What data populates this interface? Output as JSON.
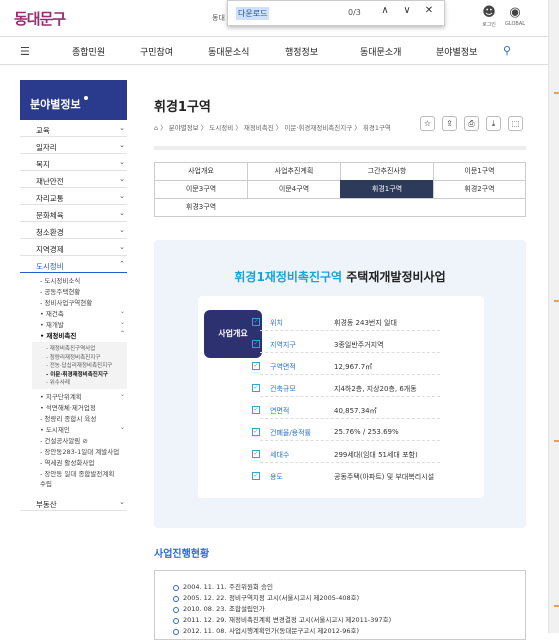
{
  "header": {
    "logo": "동대문구",
    "mid_text": "동대",
    "login": "로그인",
    "global": "GLOBAL"
  },
  "find": {
    "query": "다운로드",
    "count": "0/3",
    "prev": "∧",
    "next": "∨",
    "close": "✕"
  },
  "nav": {
    "items": [
      "종합민원",
      "구민참여",
      "동대문소식",
      "행정정보",
      "동대문소개",
      "분야별정보"
    ]
  },
  "sidebar": {
    "title": "분야별정보",
    "top": [
      {
        "label": "교육",
        "chev": "⌄"
      },
      {
        "label": "일자리",
        "chev": "⌄"
      },
      {
        "label": "복지",
        "chev": "⌄"
      },
      {
        "label": "재난안전",
        "chev": "⌄"
      },
      {
        "label": "자리교통",
        "chev": "⌄"
      },
      {
        "label": "문화체육",
        "chev": "⌄"
      },
      {
        "label": "청소환경",
        "chev": "⌄"
      },
      {
        "label": "지역경제",
        "chev": "⌄"
      },
      {
        "label": "도시정비",
        "chev": "⌃"
      }
    ],
    "sub": [
      {
        "label": "- 도시정비소식",
        "chev": ""
      },
      {
        "label": "- 공동주택현황",
        "chev": ""
      },
      {
        "label": "- 정비사업구역현황",
        "chev": ""
      },
      {
        "label": "• 재건축",
        "chev": "⌄"
      },
      {
        "label": "• 재개발",
        "chev": "⌄"
      },
      {
        "label": "• 재정비촉진",
        "chev": "⌃"
      }
    ],
    "sub2": [
      "- 재정비촉진구역사업",
      "- 청량리재정비촉진지구",
      "- 전농·답십리재정비촉진지구",
      "- 이문·휘경재정비촉진지구",
      "- 위수사례"
    ],
    "sub3": [
      {
        "label": "• 지구단위계획",
        "chev": "⌄"
      },
      {
        "label": "• 석면해체·제거업정",
        "chev": ""
      },
      {
        "label": "- 청량리 종합시 육성",
        "chev": ""
      },
      {
        "label": "• 도시재인",
        "chev": "⌄"
      },
      {
        "label": "- 건설공사알림 ⊘",
        "chev": ""
      },
      {
        "label": "- 장안동283-1일대 계발사업",
        "chev": ""
      },
      {
        "label": "- 역세권 활성화사업",
        "chev": ""
      },
      {
        "label": "- 장안동 일대 종합발전계획 수립",
        "chev": ""
      }
    ],
    "last": {
      "label": "부동산",
      "chev": "⌄"
    }
  },
  "main": {
    "title": "휘경1구역",
    "breadcrumb": "⌂  〉 분야별정보 〉 도시정비 〉 재정비촉진 〉 이문·휘경재정비촉진지구 〉 휘경1구역",
    "icons": [
      "☆",
      "⇪",
      "⎙",
      "⤓",
      "⬚"
    ],
    "tabs": [
      "사업개요",
      "사업추진계획",
      "그간추진사항",
      "이문1구역",
      "이문3구역",
      "이문4구역",
      "휘경1구역",
      "휘경2구역",
      "휘경3구역"
    ],
    "panel_title_a": "휘경1재정비촉진구역",
    "panel_title_b": " 주택재개발정비사업",
    "badge": "사업개요",
    "rows": [
      {
        "label": "위치",
        "value": "휘경동 243번지 일대"
      },
      {
        "label": "지역지구",
        "value": "3종일반주거지역"
      },
      {
        "label": "구역면적",
        "value": "12,967.7㎡"
      },
      {
        "label": "건축규모",
        "value": "지4하2층, 지상20층, 6개동"
      },
      {
        "label": "연면적",
        "value": "40,857.34㎡"
      },
      {
        "label": "건폐율/용적률",
        "value": "25.76% / 253.69%"
      },
      {
        "label": "세대수",
        "value": "299세대(임대 51세대 포함)"
      },
      {
        "label": "용도",
        "value": "공동주택(아파트) 및 부대복리시설"
      }
    ],
    "history_title": "사업진행현황",
    "history": [
      {
        "date": "2004. 11. 11.",
        "text": "주진위원회 승인"
      },
      {
        "date": "2005. 12. 22.",
        "text": "정비구역지정 고시(서울시고시 제2005-408호)"
      },
      {
        "date": "2010. 08. 23.",
        "text": "조합설립인가"
      },
      {
        "date": "2011. 12. 29.",
        "text": "재정비촉진계획 변경결정 고시(서울시고시 제2011-397호)"
      },
      {
        "date": "2012. 11. 08.",
        "text": "사업시행계획인가(동대문구고시 제2012-96호)"
      }
    ]
  }
}
